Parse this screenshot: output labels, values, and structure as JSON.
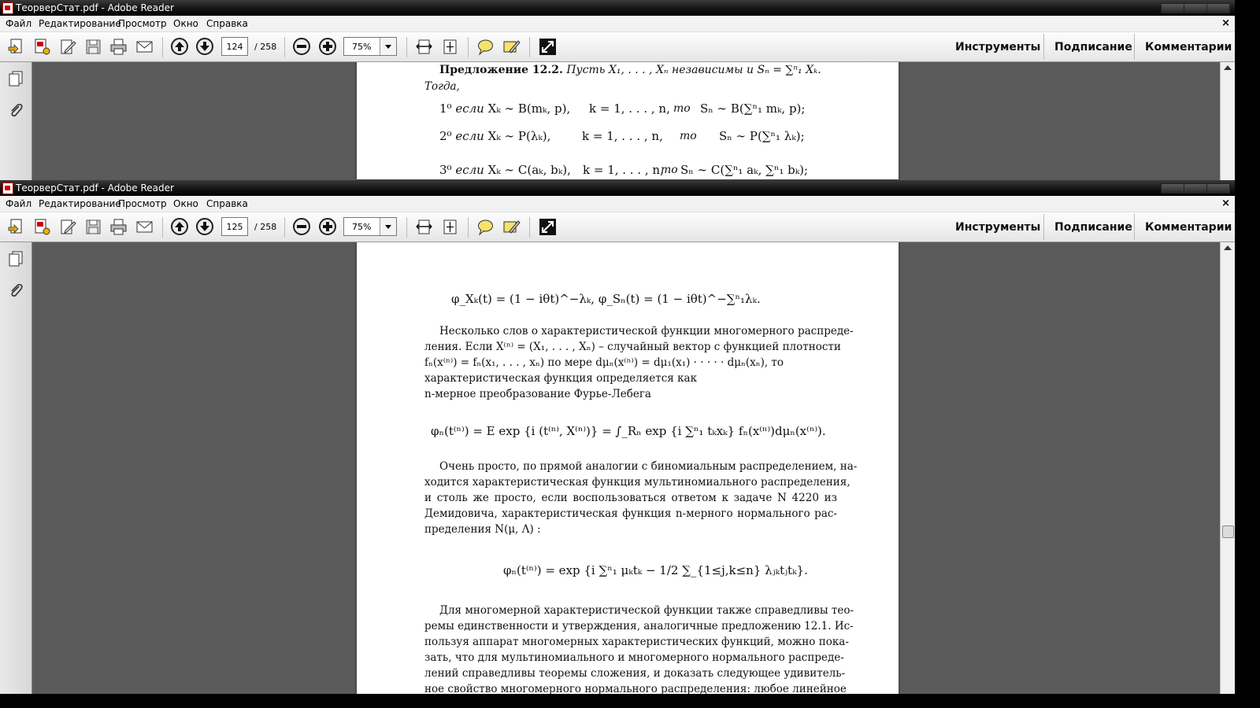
{
  "windows": [
    {
      "title": "ТеорверСтат.pdf - Adobe Reader",
      "menu": [
        "Файл",
        "Редактирование",
        "Просмотр",
        "Окно",
        "Справка"
      ],
      "page_current": "124",
      "page_total": "/ 258",
      "zoom": "75%",
      "right_buttons": [
        "Инструменты",
        "Подписание",
        "Комментарии"
      ]
    },
    {
      "title": "ТеорверСтат.pdf - Adobe Reader",
      "menu": [
        "Файл",
        "Редактирование",
        "Просмотр",
        "Окно",
        "Справка"
      ],
      "page_current": "125",
      "page_total": "/ 258",
      "zoom": "75%",
      "right_buttons": [
        "Инструменты",
        "Подписание",
        "Комментарии"
      ]
    }
  ],
  "doc1": {
    "prop_title": "Предложение 12.2.",
    "prop_text": "Пусть X₁, . . . , Xₙ независимы и Sₙ = ∑ⁿ₁ Xₖ.",
    "then": "Тогда,",
    "items": [
      {
        "num": "1⁰",
        "cond": "если",
        "expr": "Xₖ ∼ B(mₖ, p),",
        "range": "k = 1, . . . , n,",
        "then": "то",
        "res": "Sₙ ∼ B(∑ⁿ₁ mₖ, p);"
      },
      {
        "num": "2⁰",
        "cond": "если",
        "expr": "Xₖ ∼ P(λₖ),",
        "range": "k = 1, . . . , n,",
        "then": "то",
        "res": "Sₙ ∼ P(∑ⁿ₁ λₖ);"
      },
      {
        "num": "3⁰",
        "cond": "если",
        "expr": "Xₖ ∼ C(aₖ, bₖ),",
        "range": "k = 1, . . . , n,",
        "then": "то",
        "res": "Sₙ ∼ C(∑ⁿ₁ aₖ, ∑ⁿ₁ bₖ);"
      }
    ]
  },
  "doc2": {
    "formula1": "φ_Xₖ(t) = (1 − iθt)^−λₖ,  φ_Sₙ(t) = (1 − iθt)^−∑ⁿ₁λₖ.",
    "para1": [
      "Несколько слов о характеристической функции многомерного распреде-",
      "ления. Если X⁽ⁿ⁾ = (X₁, . . . , Xₙ) – случайный вектор с функцией плотности",
      "fₙ(x⁽ⁿ⁾) = fₙ(x₁, . . . , xₙ) по мере dμₙ(x⁽ⁿ⁾) = dμ₁(x₁) · · · · · dμₙ(xₙ),   то",
      "характеристическая   функция   определяется   как",
      "n-мерное преобразование Фурье-Лебега"
    ],
    "formula2": "φₙ(t⁽ⁿ⁾) = E exp {i (t⁽ⁿ⁾, X⁽ⁿ⁾)} = ∫_Rₙ exp {i ∑ⁿ₁ tₖxₖ} fₙ(x⁽ⁿ⁾)dμₙ(x⁽ⁿ⁾).",
    "para2": [
      "Очень просто, по прямой аналогии с биномиальным распределением, на-",
      "ходится характеристическая функция мультиномиального распределения,",
      "и столь же просто, если воспользоваться  ответом к задаче N 4220  из",
      "Демидовича,  характеристическая  функция n-мерного нормального рас-",
      "пределения N(μ, Λ) :"
    ],
    "formula3": "φₙ(t⁽ⁿ⁾) = exp {i ∑ⁿ₁ μₖtₖ − 1/2 ∑_{1≤j,k≤n} λⱼₖtⱼtₖ}.",
    "para3": [
      "Для многомерной характеристической функции также справедливы тео-",
      "ремы единственности и утверждения, аналогичные предложению 12.1. Ис-",
      "пользуя аппарат многомерных характеристических функций, можно пока-",
      "зать, что для мультиномиального и многомерного нормального распреде-",
      "лений справедливы теоремы сложения, и доказать следующее удивитель-",
      "ное свойство многомерного нормального распределения: любое линейное"
    ]
  }
}
